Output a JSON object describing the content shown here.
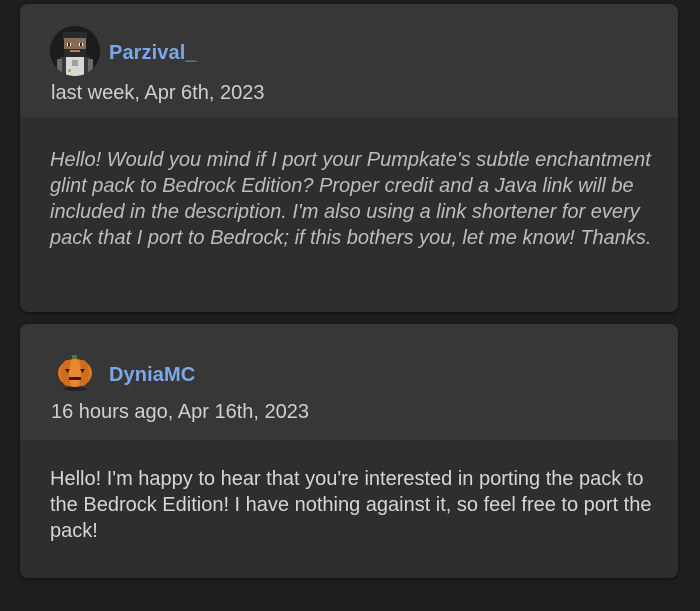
{
  "comments": [
    {
      "username": "Parzival_",
      "timestamp": "last week, Apr 6th, 2023",
      "avatar_icon": "pixel-character-avatar",
      "body": "Hello! Would you mind if I port your Pumpkate's subtle enchantment glint pack to Bedrock Edition? Proper credit and a Java link will be included in the description. I'm also using a link shortener for every pack that I port to Bedrock; if this bothers you, let me know! Thanks."
    },
    {
      "username": "DyniaMC",
      "timestamp": "16 hours ago, Apr 16th, 2023",
      "avatar_icon": "pumpkin-avatar",
      "body": "Hello! I'm happy to hear that you're interested in porting the pack to the Bedrock Edition! I have nothing against it, so feel free to port the pack!"
    }
  ],
  "colors": {
    "background": "#1e1e1e",
    "card": "#2e2e2e",
    "card_header": "#373737",
    "username": "#7aa8ea",
    "text": "#cfcfcf"
  }
}
